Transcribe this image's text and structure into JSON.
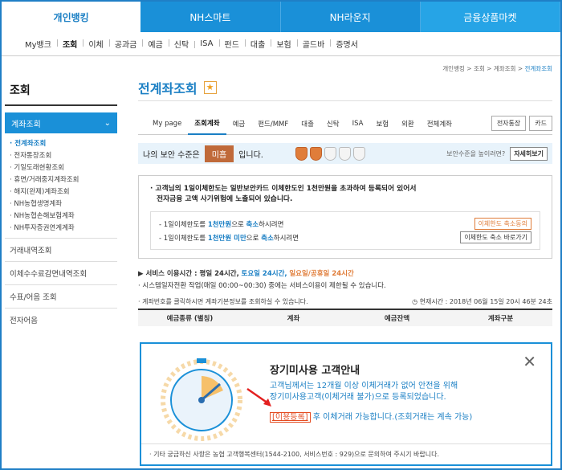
{
  "topnav": [
    "개인뱅킹",
    "NH스마트",
    "NH라운지",
    "금융상품마켓"
  ],
  "subnav": [
    "My뱅크",
    "조회",
    "이체",
    "공과금",
    "예금",
    "신탁",
    "ISA",
    "펀드",
    "대출",
    "보험",
    "골드바",
    "증명서"
  ],
  "side": {
    "title": "조회",
    "selected": "계좌조회",
    "sub": [
      "· 전계좌조회",
      "· 전자통장조회",
      "· 기일도래현황조회",
      "· 휴면/거래중지계좌조회",
      "· 해지(완제)계좌조회",
      "· NH농협생명계좌",
      "· NH농협손해보험계좌",
      "· NH투자증권연계계좌"
    ],
    "links": [
      "거래내역조회",
      "이체수수료감면내역조회",
      "수표/어음 조회",
      "전자어음"
    ]
  },
  "main": {
    "crumb": [
      "개인뱅킹",
      "조회",
      "계좌조회",
      "전계좌조회"
    ],
    "title": "전계좌조회",
    "tabs": [
      "My page",
      "조회계좌",
      "예금",
      "펀드/MMF",
      "대출",
      "신탁",
      "ISA",
      "보험",
      "외환",
      "전체계좌"
    ],
    "tab_buttons": [
      "전자통장",
      "카드"
    ],
    "security": {
      "label": "나의 보안 수준은",
      "level": "미흡",
      "suffix": "입니다.",
      "right": "보안수준을 높이려면?",
      "right_btn": "자세히보기"
    },
    "notice": {
      "line1": "· 고객님의 1일이체한도는 일반보안카드 이체한도인 1천만원을 초과하여 등록되어 있어서",
      "line2": "전자금융 고액 사기위험에 노출되어 있습니다.",
      "row1_pre": "- 1일이체한도를",
      "row1_hl": "1천만원",
      "row1_mid": "으로",
      "row1_hl2": "축소",
      "row1_post": "하시려면",
      "row1_btn": "이체한도 축소동의",
      "row2_pre": "- 1일이체한도를",
      "row2_hl": "1천만원 미만",
      "row2_mid": "으로",
      "row2_hl2": "축소",
      "row2_post": "하시려면",
      "row2_btn": "이체한도 축소 바로가기"
    },
    "info": {
      "a_pre": "▶ 서비스 이용시간 : 평일 24시간,",
      "a_blue": "토요일 24시간,",
      "a_orange": "일요일/공휴일 24시간",
      "b": "· 시스템일자전환 작업(매일 00:00~00:30) 중에는 서비스이용이 제한될 수 있습니다.",
      "c": "· 계좌번호를 클릭하시면 계좌기본정보를 조회하실 수 있습니다.",
      "time": "현재시간 : 2018년 06월 15일 20시 46분 24초"
    },
    "thead": [
      "예금종류 (별칭)",
      "계좌",
      "예금잔액",
      "계좌구분"
    ]
  },
  "popup": {
    "title": "장기미사용 고객안내",
    "line1": "고객님께서는 12개월 이상 이체거래가 없어 안전을 위해",
    "line2": "장기미사용고객(이체거래 불가)으로 등록되었습니다.",
    "link": "[이용등록]",
    "line3": " 후 이체거래 가능합니다.(조회거래는 계속 가능)",
    "foot": "· 기타 궁금하신 사항은 농협 고객행복센터(1544-2100, 서비스번호 : 929)으로 문의하여 주시기 바랍니다.",
    "close": "✕"
  },
  "colors": {
    "accent": "#1a90d8",
    "warn": "#e07d3a",
    "link": "#e34b20"
  }
}
